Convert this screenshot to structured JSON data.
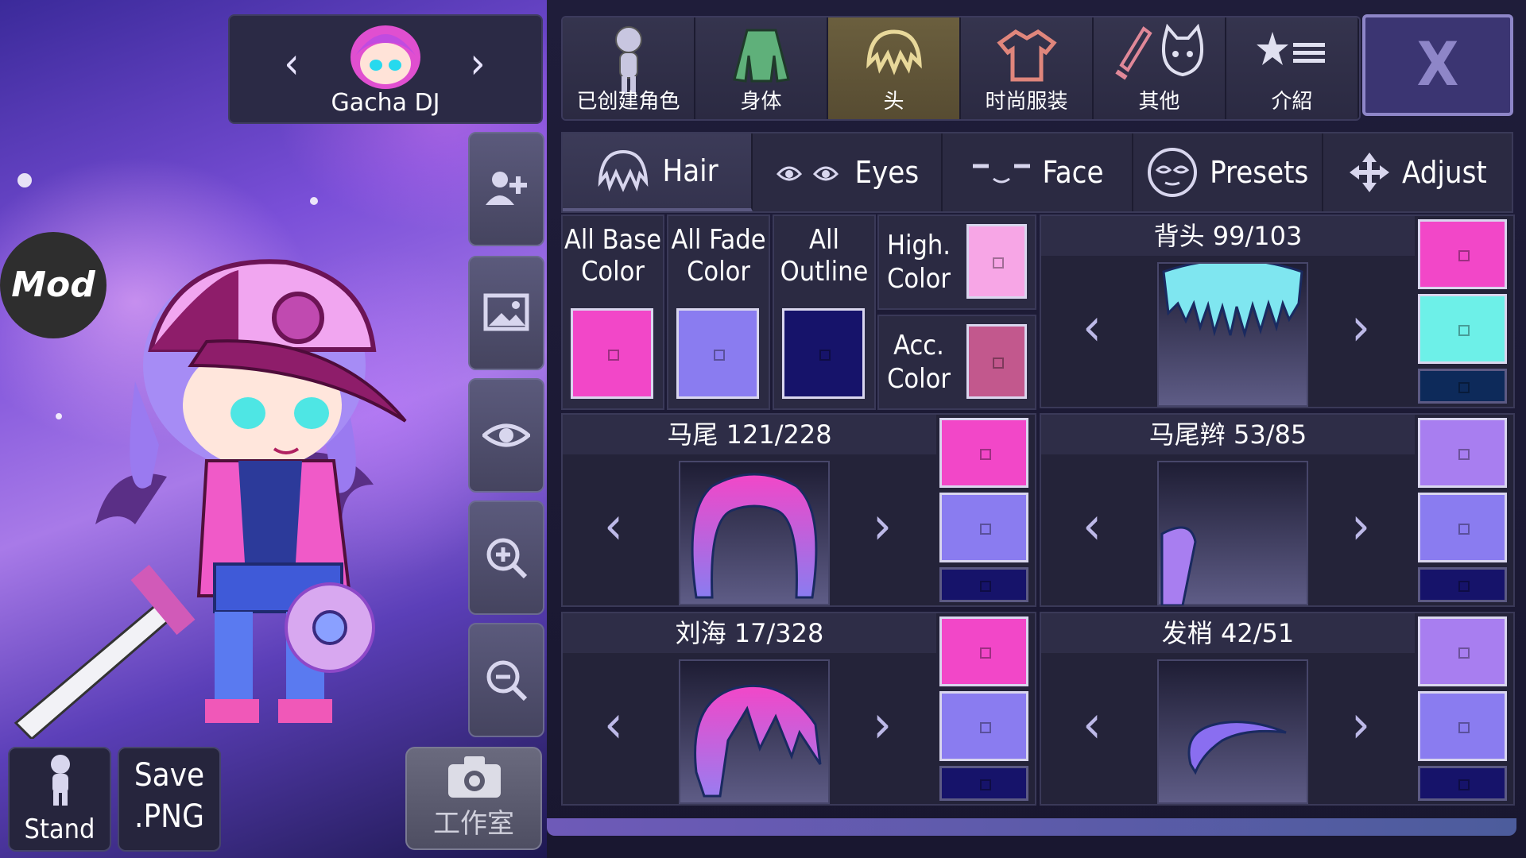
{
  "character": {
    "name": "Gacha DJ",
    "prev_icon": "chevron-left-icon",
    "next_icon": "chevron-right-icon"
  },
  "mod_badge": "Mod",
  "side_tools": [
    "add-character-icon",
    "background-image-icon",
    "eye-icon",
    "zoom-in-icon",
    "zoom-out-icon"
  ],
  "bottom_buttons": {
    "stand": "Stand",
    "save": "Save\n.PNG",
    "studio": "工作室"
  },
  "top_tabs": [
    {
      "label": "已创建角色",
      "icon": "character-icon",
      "active": false
    },
    {
      "label": "身体",
      "icon": "body-icon",
      "active": false
    },
    {
      "label": "头",
      "icon": "hair-icon",
      "active": true
    },
    {
      "label": "时尚服装",
      "icon": "shirt-icon",
      "active": false
    },
    {
      "label": "其他",
      "icon": "sword-cat-icon",
      "active": false
    },
    {
      "label": "介紹",
      "icon": "star-list-icon",
      "active": false
    }
  ],
  "close_label": "X",
  "sub_tabs": [
    {
      "label": "Hair",
      "icon": "hair-icon",
      "active": true
    },
    {
      "label": "Eyes",
      "icon": "eyes-icon",
      "active": false
    },
    {
      "label": "Face",
      "icon": "face-icon",
      "active": false
    },
    {
      "label": "Presets",
      "icon": "mask-icon",
      "active": false
    },
    {
      "label": "Adjust",
      "icon": "move-icon",
      "active": false
    }
  ],
  "color_columns": [
    {
      "label": "All Base\nColor",
      "color": "#f247c8"
    },
    {
      "label": "All Fade\nColor",
      "color": "#8a7cf0"
    },
    {
      "label": "All\nOutline",
      "color": "#16136a"
    }
  ],
  "mini_colors": [
    {
      "label": "High.\nColor",
      "color": "#f7a6e6"
    },
    {
      "label": "Acc.\nColor",
      "color": "#c2588d"
    }
  ],
  "hair_parts": [
    {
      "title": "背头 99/103",
      "colors": [
        "#f247c8",
        "#6df0e8",
        "#0d2a5a"
      ]
    },
    {
      "title": "马尾 121/228",
      "colors": [
        "#f247c8",
        "#8a7cf0",
        "#16136a"
      ]
    },
    {
      "title": "马尾辫 53/85",
      "colors": [
        "#a87ef0",
        "#8a7cf0",
        "#16136a"
      ]
    },
    {
      "title": "刘海 17/328",
      "colors": [
        "#f247c8",
        "#8a7cf0",
        "#16136a"
      ]
    },
    {
      "title": "发梢 42/51",
      "colors": [
        "#a87ef0",
        "#8a7cf0",
        "#16136a"
      ]
    }
  ]
}
